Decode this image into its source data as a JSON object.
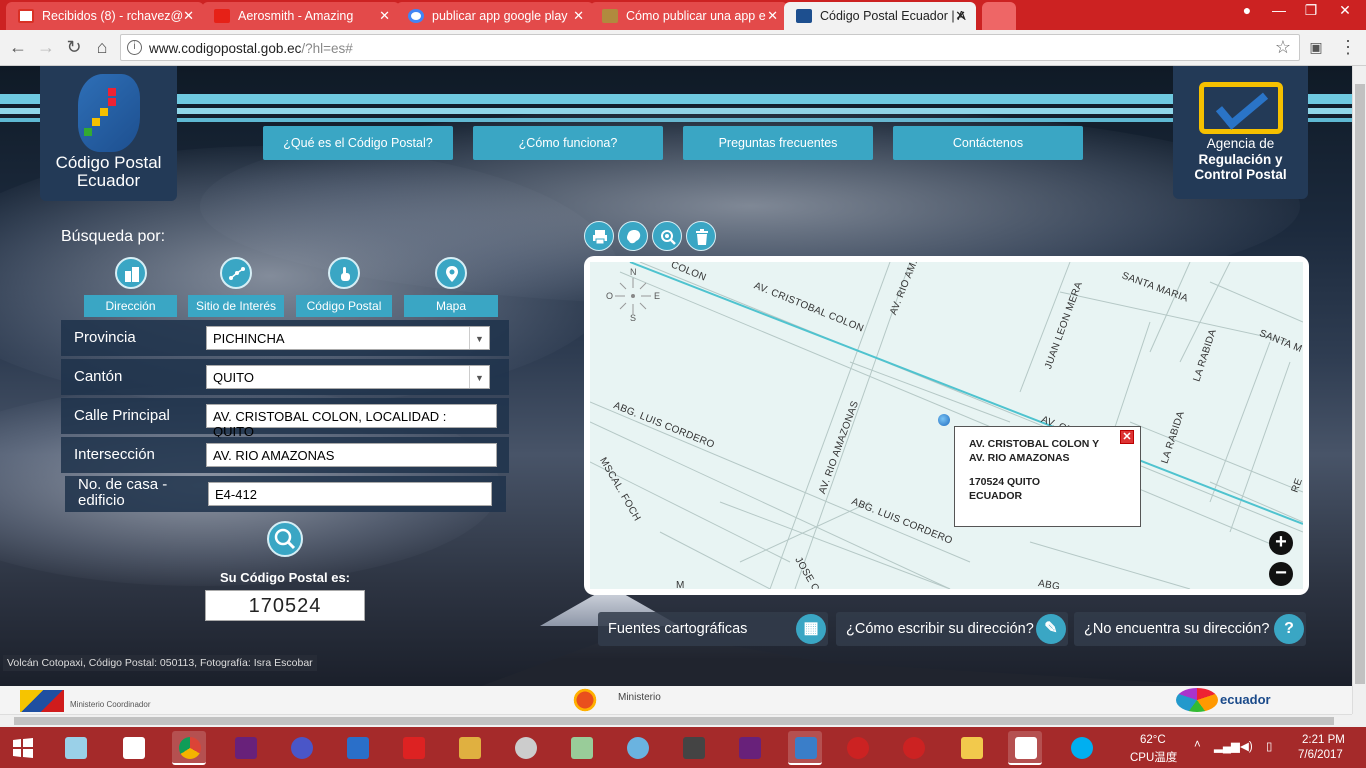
{
  "browser": {
    "tabs": [
      {
        "label": "Recibidos (8) - rchavez@",
        "favicon_color": "#d93025"
      },
      {
        "label": "Aerosmith - Amazing",
        "favicon_color": "#e62117"
      },
      {
        "label": "publicar app google play",
        "favicon_color": "#4285f4"
      },
      {
        "label": "Cómo publicar una app e",
        "favicon_color": "#b08a3e"
      },
      {
        "label": "Código Postal Ecuador | A",
        "favicon_color": "#1d4f8f"
      }
    ],
    "url_host": "www.codigopostal.gob.ec",
    "url_path": "/?hl=es#"
  },
  "site": {
    "logo_left_text": "Código Postal Ecuador",
    "logo_right_line1": "Agencia de",
    "logo_right_line2": "Regulación y Control Postal",
    "nav": [
      "¿Qué es el Código Postal?",
      "¿Cómo funciona?",
      "Preguntas frecuentes",
      "Contáctenos"
    ],
    "search_by_label": "Búsqueda por:",
    "modes": [
      "Dirección",
      "Sitio de Interés",
      "Código Postal",
      "Mapa"
    ]
  },
  "form": {
    "provincia_label": "Provincia",
    "provincia_value": "PICHINCHA",
    "canton_label": "Cantón",
    "canton_value": "QUITO",
    "calle_label": "Calle Principal",
    "calle_value": "AV. CRISTOBAL COLON, LOCALIDAD : QUITO",
    "interseccion_label": "Intersección",
    "interseccion_value": "AV. RIO AMAZONAS",
    "numero_label_1": "No. de casa -",
    "numero_label_2": "edificio",
    "numero_value": "E4-412"
  },
  "result": {
    "label": "Su Código Postal es:",
    "value": "170524"
  },
  "photo_credit": "Volcán Cotopaxi, Código Postal: 050113, Fotografía: Isra Escobar",
  "map": {
    "compass": {
      "n": "N",
      "s": "S",
      "e": "E",
      "o": "O"
    },
    "streets": [
      "AV. CRISTOBAL COLON",
      "AV. RIO AM.",
      "SANTA MARIA",
      "JUAN LEON MERA",
      "LA RABIDA",
      "SANTA M",
      "ABG. LUIS CORDERO",
      "AV. RIO AMAZONAS",
      "LA RABIDA",
      "MSCAL. FOCH",
      "ABG. LUIS CORDERO",
      "JOSE CA",
      "AV. CRIS",
      "COLON",
      "ABG",
      "RE",
      "M"
    ],
    "popup_line1": "AV. CRISTOBAL COLON Y",
    "popup_line2": "AV. RIO AMAZONAS",
    "popup_line3": "170524 QUITO",
    "popup_line4": "ECUADOR",
    "zoom_in": "+",
    "zoom_out": "−"
  },
  "bottom_links": [
    "Fuentes cartográficas",
    "¿Cómo escribir su dirección?",
    "¿No encuentra su dirección?"
  ],
  "footer": {
    "ministerio": "Ministerio",
    "ministerio_coord": "Ministerio Coordinador",
    "ecuador": "ecuador"
  },
  "tray": {
    "temperature": "62°C",
    "cpu_label": "CPU温度",
    "time": "2:21 PM",
    "date": "7/6/2017"
  },
  "colors": {
    "accent": "#3aa6c4",
    "tabbar": "#cc2222",
    "taskbar": "#a52a2a"
  }
}
